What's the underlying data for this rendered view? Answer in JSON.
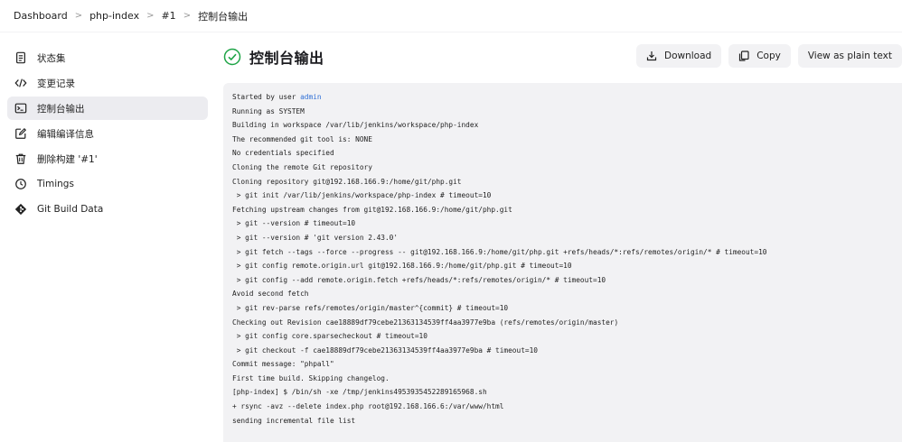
{
  "breadcrumb": [
    "Dashboard",
    "php-index",
    "#1",
    "控制台输出"
  ],
  "sidebar": {
    "items": [
      {
        "label": "状态集",
        "icon": "document-icon"
      },
      {
        "label": "变更记录",
        "icon": "code-icon"
      },
      {
        "label": "控制台输出",
        "icon": "terminal-icon",
        "active": true
      },
      {
        "label": "编辑编译信息",
        "icon": "edit-icon"
      },
      {
        "label": "删除构建 '#1'",
        "icon": "trash-icon"
      },
      {
        "label": "Timings",
        "icon": "clock-icon"
      },
      {
        "label": "Git Build Data",
        "icon": "git-icon"
      }
    ]
  },
  "header": {
    "title": "控制台输出",
    "buttons": {
      "download": "Download",
      "copy": "Copy",
      "plain": "View as plain text"
    }
  },
  "console": {
    "started_prefix": "Started by user ",
    "started_user": "admin",
    "lines": [
      "Running as SYSTEM",
      "Building in workspace /var/lib/jenkins/workspace/php-index",
      "The recommended git tool is: NONE",
      "No credentials specified",
      "Cloning the remote Git repository",
      "Cloning repository git@192.168.166.9:/home/git/php.git",
      " > git init /var/lib/jenkins/workspace/php-index # timeout=10",
      "Fetching upstream changes from git@192.168.166.9:/home/git/php.git",
      " > git --version # timeout=10",
      " > git --version # 'git version 2.43.0'",
      " > git fetch --tags --force --progress -- git@192.168.166.9:/home/git/php.git +refs/heads/*:refs/remotes/origin/* # timeout=10",
      " > git config remote.origin.url git@192.168.166.9:/home/git/php.git # timeout=10",
      " > git config --add remote.origin.fetch +refs/heads/*:refs/remotes/origin/* # timeout=10",
      "Avoid second fetch",
      " > git rev-parse refs/remotes/origin/master^{commit} # timeout=10",
      "Checking out Revision cae18889df79cebe21363134539ff4aa3977e9ba (refs/remotes/origin/master)",
      " > git config core.sparsecheckout # timeout=10",
      " > git checkout -f cae18889df79cebe21363134539ff4aa3977e9ba # timeout=10",
      "Commit message: \"phpall\"",
      "First time build. Skipping changelog.",
      "[php-index] $ /bin/sh -xe /tmp/jenkins4953935452289165968.sh",
      "+ rsync -avz --delete index.php root@192.168.166.6:/var/www/html",
      "sending incremental file list"
    ]
  }
}
